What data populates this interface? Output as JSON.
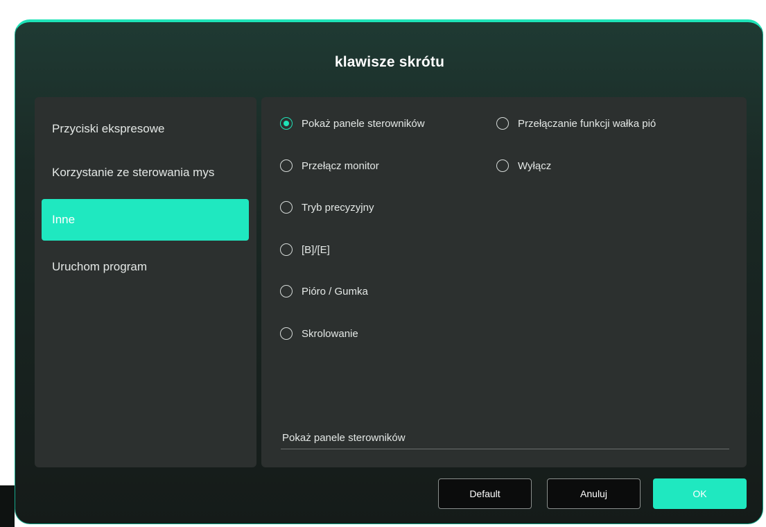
{
  "dialog": {
    "title": "klawisze skrótu"
  },
  "sidebar": {
    "items": [
      {
        "label": "Przyciski ekspresowe",
        "active": false
      },
      {
        "label": "Korzystanie ze sterowania mys",
        "active": false
      },
      {
        "label": "Inne",
        "active": true
      },
      {
        "label": "Uruchom program",
        "active": false
      }
    ]
  },
  "options": {
    "column1": [
      {
        "label": "Pokaż panele sterowników",
        "selected": true
      },
      {
        "label": "Przełącz monitor",
        "selected": false
      },
      {
        "label": "Tryb precyzyjny",
        "selected": false
      },
      {
        "label": "[B]/[E]",
        "selected": false
      },
      {
        "label": "Pióro / Gumka",
        "selected": false
      },
      {
        "label": "Skrolowanie",
        "selected": false
      }
    ],
    "column2": [
      {
        "label": "Przełączanie funkcji wałka pió",
        "selected": false
      },
      {
        "label": "Wyłącz",
        "selected": false
      }
    ]
  },
  "preview": {
    "value": "Pokaż panele sterowników"
  },
  "buttons": {
    "default_label": "Default",
    "cancel_label": "Anuluj",
    "ok_label": "OK"
  },
  "colors": {
    "accent": "#1fe8c0",
    "panel": "#2c302f",
    "dialog_top": "#1f3a33",
    "dialog_bottom": "#151b19"
  }
}
